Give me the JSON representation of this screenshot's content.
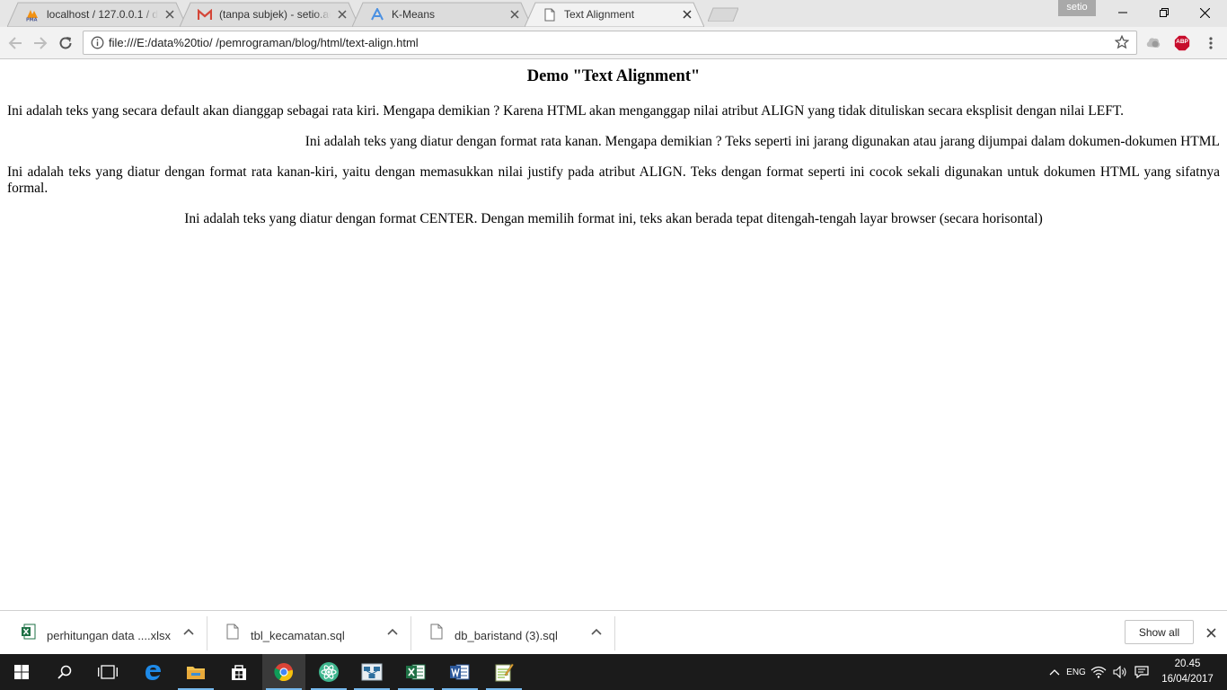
{
  "browser": {
    "tabs": [
      {
        "title": "localhost / 127.0.0.1 / db",
        "favicon": "phpmyadmin-icon",
        "active": false
      },
      {
        "title": "(tanpa subjek) - setio.adi",
        "favicon": "gmail-icon",
        "active": false
      },
      {
        "title": "K-Means",
        "favicon": "k-means-a-icon",
        "active": false
      },
      {
        "title": "Text Alignment",
        "favicon": "page-icon",
        "active": true
      }
    ],
    "profile_name": "setio",
    "address_url": "file:///E:/data%20tio/ /pemrograman/blog/html/text-align.html",
    "extensions": [
      "grey-extension-icon",
      "adblock-plus-icon"
    ],
    "extension_labels": {
      "adblock": "ABP"
    }
  },
  "page": {
    "heading": "Demo \"Text Alignment\"",
    "paragraphs": {
      "left": "Ini adalah teks yang secara default akan dianggap sebagai rata kiri. Mengapa demikian ? Karena HTML akan menganggap nilai atribut ALIGN yang tidak dituliskan secara eksplisit dengan nilai LEFT.",
      "right": "Ini adalah teks yang diatur dengan format rata kanan. Mengapa demikian ? Teks seperti ini jarang digunakan atau jarang dijumpai dalam dokumen-dokumen HTML",
      "justify": "Ini adalah teks yang diatur dengan format rata kanan-kiri, yaitu dengan memasukkan nilai justify pada atribut ALIGN. Teks dengan format seperti ini cocok sekali digunakan untuk dokumen HTML yang sifatnya formal.",
      "center": "Ini adalah teks yang diatur dengan format CENTER. Dengan memilih format ini, teks akan berada tepat ditengah-tengah layar browser (secara horisontal)"
    }
  },
  "downloads": {
    "items": [
      {
        "name": "perhitungan data ....xlsx",
        "icon": "excel-file-icon"
      },
      {
        "name": "tbl_kecamatan.sql",
        "icon": "file-icon"
      },
      {
        "name": "db_baristand (3).sql",
        "icon": "file-icon"
      }
    ],
    "show_all_label": "Show all"
  },
  "taskbar": {
    "apps": [
      "start-icon",
      "search-icon",
      "task-view-icon",
      "edge-icon",
      "file-explorer-icon",
      "store-icon",
      "chrome-icon",
      "atom-icon",
      "network-app-icon",
      "excel-icon",
      "word-icon",
      "notepadpp-icon"
    ],
    "tray_lang": "ENG",
    "time": "20.45",
    "date": "16/04/2017"
  },
  "colors": {
    "tabstrip": "#e6e6e6",
    "toolbar": "#f2f2f2",
    "taskbar": "#1b1b1b",
    "running_indicator": "#76b9ed",
    "adblock_red": "#c70d2c"
  }
}
